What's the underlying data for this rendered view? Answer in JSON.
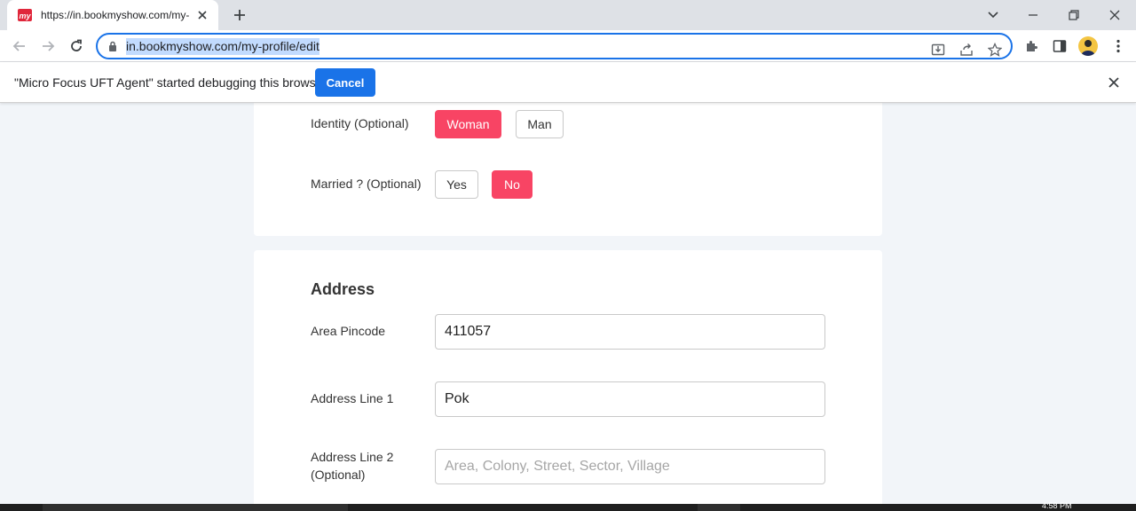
{
  "browser": {
    "tab_title": "https://in.bookmyshow.com/my-profile/edit",
    "url": "in.bookmyshow.com/my-profile/edit",
    "favicon_label": "my",
    "accent_color": "#1a73e8"
  },
  "infobar": {
    "message": "\"Micro Focus UFT Agent\" started debugging this browser",
    "cancel_label": "Cancel"
  },
  "personal": {
    "identity_label": "Identity (Optional)",
    "identity_options": [
      "Woman",
      "Man"
    ],
    "identity_selected": "Woman",
    "married_label": "Married ? (Optional)",
    "married_options": [
      "Yes",
      "No"
    ],
    "married_selected": "No"
  },
  "address": {
    "title": "Address",
    "pincode_label": "Area Pincode",
    "pincode_value": "411057",
    "line1_label": "Address Line 1",
    "line1_value": "Pok",
    "line2_label": "Address Line 2 (Optional)",
    "line2_placeholder": "Area, Colony, Street, Sector, Village",
    "line2_value": ""
  },
  "theme": {
    "selected_color": "#f84464",
    "page_bg": "#f2f5f9"
  },
  "taskbar": {
    "time": "4:58 PM"
  }
}
